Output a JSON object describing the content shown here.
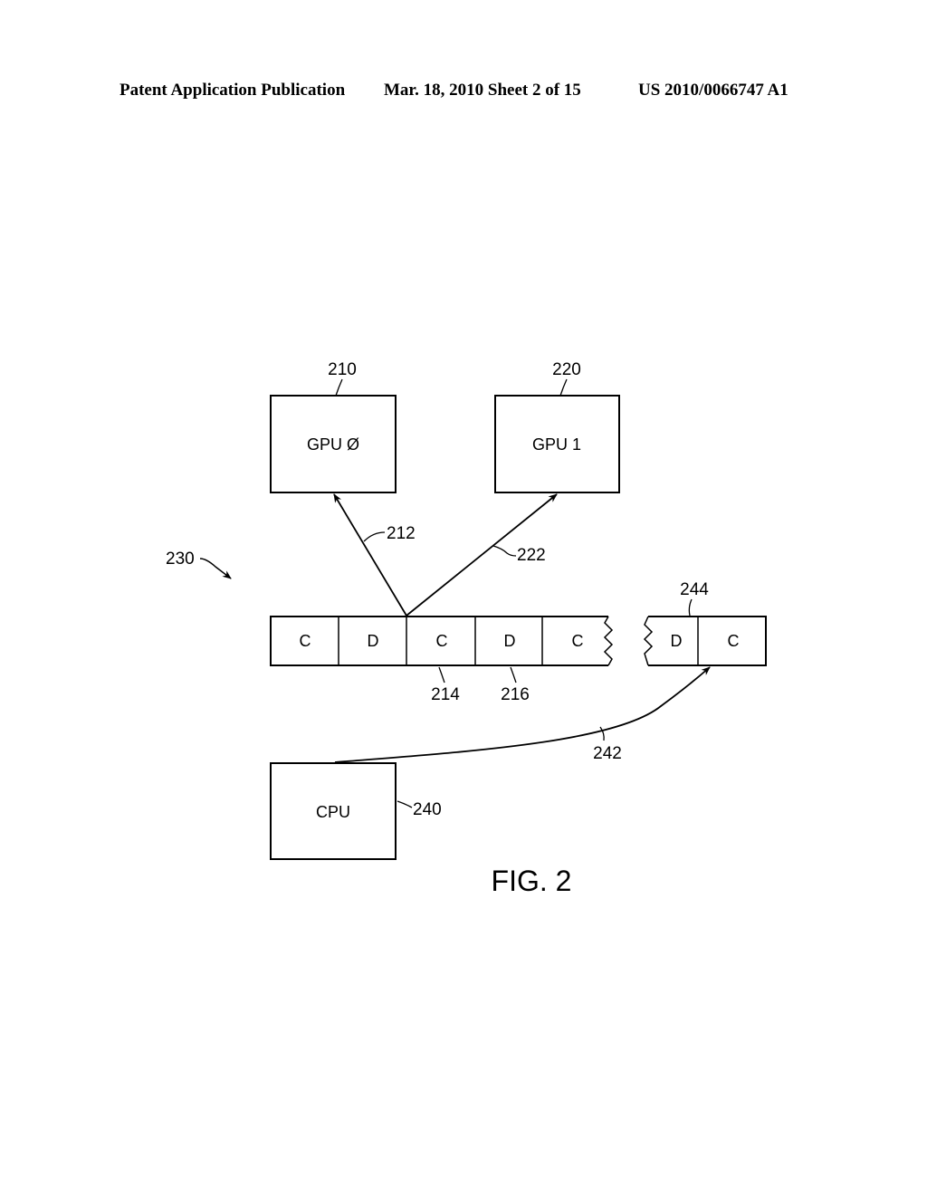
{
  "header": {
    "publication": "Patent Application Publication",
    "date_sheet": "Mar. 18, 2010  Sheet 2 of 15",
    "number": "US 2010/0066747 A1"
  },
  "diagram": {
    "gpu0": {
      "label": "GPU Ø",
      "ref": "210"
    },
    "gpu1": {
      "label": "GPU 1",
      "ref": "220"
    },
    "cpu": {
      "label": "CPU",
      "ref": "240"
    },
    "buffer_ref": "230",
    "arrow_gpu0_ref": "212",
    "arrow_gpu1_ref": "222",
    "arrow_cpu_ref": "242",
    "cells_left": [
      "C",
      "D",
      "C",
      "D",
      "C"
    ],
    "cells_right": [
      "D",
      "C"
    ],
    "cell_refs": {
      "c3": "214",
      "d4": "216",
      "right_d": "244"
    },
    "figure_label": "FIG. 2"
  }
}
